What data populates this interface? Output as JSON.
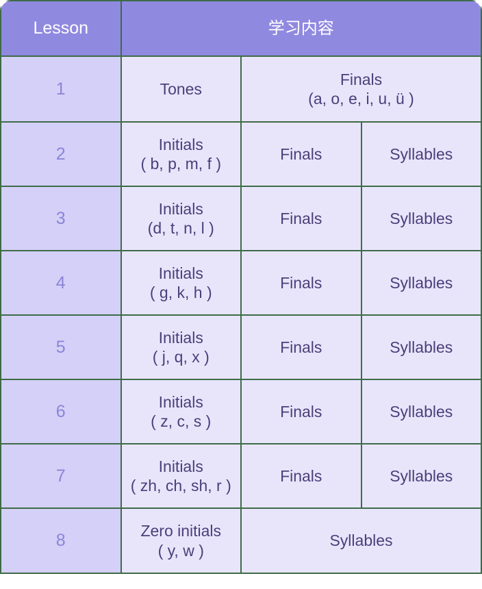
{
  "table": {
    "header": {
      "lesson_label": "Lesson",
      "content_label": "学习内容"
    },
    "colors": {
      "header_background": "#9089e0",
      "header_text": "#ffffff",
      "number_cell_background": "#d5d0f7",
      "number_text": "#8b85d8",
      "body_cell_background": "#e8e5fb",
      "body_text": "#4b3f7a",
      "border": "#3d6b47",
      "page_background": "#ffffff"
    },
    "rows": [
      {
        "number": "1",
        "cells": [
          {
            "line1": "Tones",
            "line2": ""
          },
          {
            "line1": "Finals",
            "line2": "(a, o, e, i, u, ü )"
          }
        ]
      },
      {
        "number": "2",
        "cells": [
          {
            "line1": "Initials",
            "line2": "( b, p, m, f )"
          },
          {
            "line1": "Finals",
            "line2": ""
          },
          {
            "line1": "Syllables",
            "line2": ""
          }
        ]
      },
      {
        "number": "3",
        "cells": [
          {
            "line1": "Initials",
            "line2": "(d, t, n, l )"
          },
          {
            "line1": "Finals",
            "line2": ""
          },
          {
            "line1": "Syllables",
            "line2": ""
          }
        ]
      },
      {
        "number": "4",
        "cells": [
          {
            "line1": "Initials",
            "line2": "( g, k, h )"
          },
          {
            "line1": "Finals",
            "line2": ""
          },
          {
            "line1": "Syllables",
            "line2": ""
          }
        ]
      },
      {
        "number": "5",
        "cells": [
          {
            "line1": "Initials",
            "line2": "( j, q, x )"
          },
          {
            "line1": "Finals",
            "line2": ""
          },
          {
            "line1": "Syllables",
            "line2": ""
          }
        ]
      },
      {
        "number": "6",
        "cells": [
          {
            "line1": "Initials",
            "line2": "( z, c, s )"
          },
          {
            "line1": "Finals",
            "line2": ""
          },
          {
            "line1": "Syllables",
            "line2": ""
          }
        ]
      },
      {
        "number": "7",
        "cells": [
          {
            "line1": "Initials",
            "line2": "( zh, ch, sh, r )"
          },
          {
            "line1": "Finals",
            "line2": ""
          },
          {
            "line1": "Syllables",
            "line2": ""
          }
        ]
      },
      {
        "number": "8",
        "cells": [
          {
            "line1": "Zero initials",
            "line2": "( y, w )"
          },
          {
            "line1": "Syllables",
            "line2": ""
          }
        ]
      }
    ]
  }
}
